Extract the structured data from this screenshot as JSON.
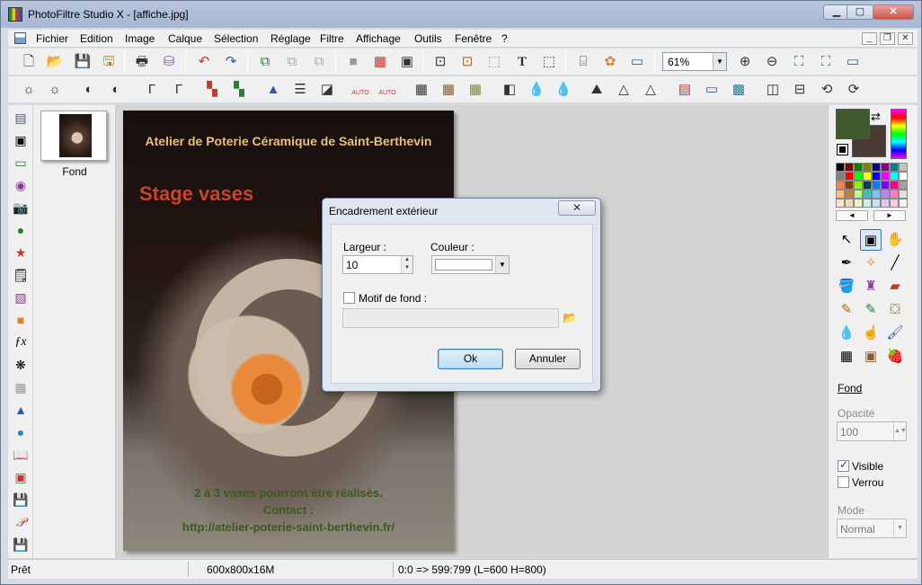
{
  "window": {
    "title": "PhotoFiltre Studio X - [affiche.jpg]",
    "minimize": "▁",
    "maximize": "▢",
    "close": "✕"
  },
  "menu": {
    "items": [
      "Fichier",
      "Edition",
      "Image",
      "Calque",
      "Sélection",
      "Réglage",
      "Filtre",
      "Affichage",
      "Outils",
      "Fenêtre",
      "?"
    ],
    "mdi_min": "_",
    "mdi_restore": "❐",
    "mdi_close": "✕"
  },
  "toolbar": {
    "zoom_value": "61%",
    "zoom_arrow": "▼",
    "text_tool": "T",
    "auto_labels": [
      "AUTO",
      "AUTO"
    ]
  },
  "layers": {
    "items": [
      {
        "label": "Fond"
      }
    ]
  },
  "canvas": {
    "header": "Atelier de Poterie Céramique de Saint-Berthevin",
    "stage": "Stage vases",
    "line1": "2 à 3 vases pourront être réalisés.",
    "line2": "Contact :",
    "line3": "http://atelier-poterie-saint-berthevin.fr/"
  },
  "dialog": {
    "title": "Encadrement extérieur",
    "close": "✕",
    "width_label": "Largeur :",
    "width_value": "10",
    "color_label": "Couleur :",
    "motif_label": "Motif de fond :",
    "motif_checked": false,
    "ok_label": "Ok",
    "cancel_label": "Annuler",
    "spin_up": "▲",
    "spin_down": "▼",
    "combo_arrow": "▼"
  },
  "right_panel": {
    "foreground_color": "#3f5a2e",
    "background_color": "#4a3a33",
    "pal_prev": "◄",
    "pal_next": "►",
    "layer_name": "Fond",
    "opacity_label": "Opacité",
    "opacity_value": "100",
    "visible_label": "Visible",
    "visible_checked": true,
    "lock_label": "Verrou",
    "lock_checked": false,
    "mode_label": "Mode",
    "mode_value": "Normal"
  },
  "status": {
    "state": "Prêt",
    "image_info": "600x800x16M",
    "coords": "0:0 => 599:799 (L=600  H=800)"
  },
  "colors": {
    "titlebar": "#a6b7d3",
    "panel": "#f0f0f0",
    "workspace": "#d4d4d4",
    "ok_button": "#bcdcf4"
  }
}
